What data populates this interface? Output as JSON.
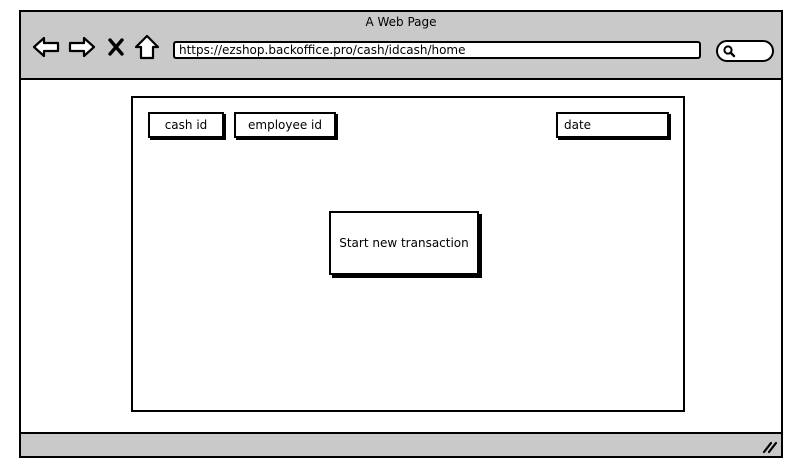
{
  "window": {
    "title": "A Web Page"
  },
  "toolbar": {
    "back_icon": "back-arrow-icon",
    "forward_icon": "forward-arrow-icon",
    "stop_icon": "close-icon",
    "home_icon": "home-icon",
    "search_icon": "search-icon"
  },
  "address_bar": {
    "url": "https://ezshop.backoffice.pro/cash/idcash/home"
  },
  "main": {
    "cash_id_label": "cash id",
    "employee_id_label": "employee id",
    "date_label": "date",
    "start_button_label": "Start new transaction"
  },
  "statusbar": {
    "resize_icon": "resize-grip-icon"
  },
  "colors": {
    "chrome": "#c9c9c9",
    "background": "#ffffff",
    "stroke": "#000000"
  }
}
